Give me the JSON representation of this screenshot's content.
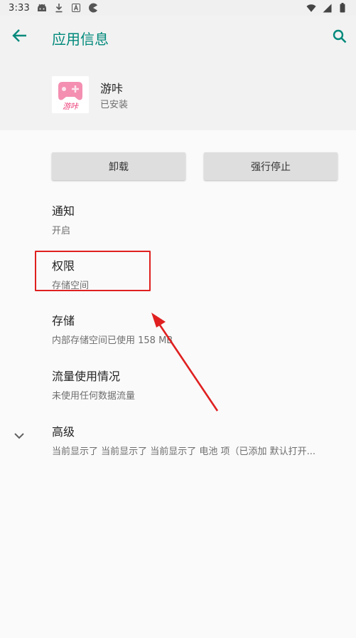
{
  "status_bar": {
    "time": "3:33",
    "left_icons": [
      "android-debug-icon",
      "download-icon",
      "app-a-icon",
      "pacman-icon"
    ],
    "right_icons": [
      "wifi-icon",
      "cellular-signal-icon",
      "battery-icon"
    ]
  },
  "app_bar": {
    "title": "应用信息",
    "back_icon": "back-arrow-icon",
    "search_icon": "search-icon",
    "accent_color": "#00897b"
  },
  "app": {
    "name": "游咔",
    "status": "已安装",
    "icon_text": "游咔",
    "icon_color": "#f06292"
  },
  "buttons": {
    "uninstall": "卸载",
    "force_stop": "强行停止"
  },
  "items": [
    {
      "title": "通知",
      "summary": "开启"
    },
    {
      "title": "权限",
      "summary": "存储空间"
    },
    {
      "title": "存储",
      "summary": "内部存储空间已使用 158 MB"
    },
    {
      "title": "流量使用情况",
      "summary": "未使用任何数据流量"
    },
    {
      "title": "高级",
      "summary": "当前显示了 当前显示了 当前显示了 电池 项（已添加 默认打开..."
    }
  ],
  "annotation": {
    "highlight_color": "#e02020",
    "arrow_color": "#e02020"
  }
}
